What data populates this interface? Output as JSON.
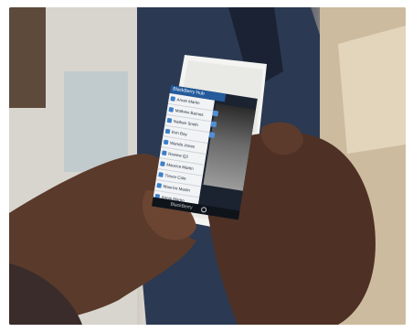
{
  "photo": {
    "description_label": "",
    "screen": {
      "header_text": "BlackBerry Hub",
      "list_items": [
        "Annie Martin",
        "Mathew Barnes",
        "Nathan Smith",
        "Erin Bay",
        "Wanda Jones",
        "Review Q2",
        "Maurice Martin",
        "Trevor Cole",
        "Maurice Martin",
        "Annie Martin"
      ],
      "brand": "BlackBerry"
    }
  }
}
